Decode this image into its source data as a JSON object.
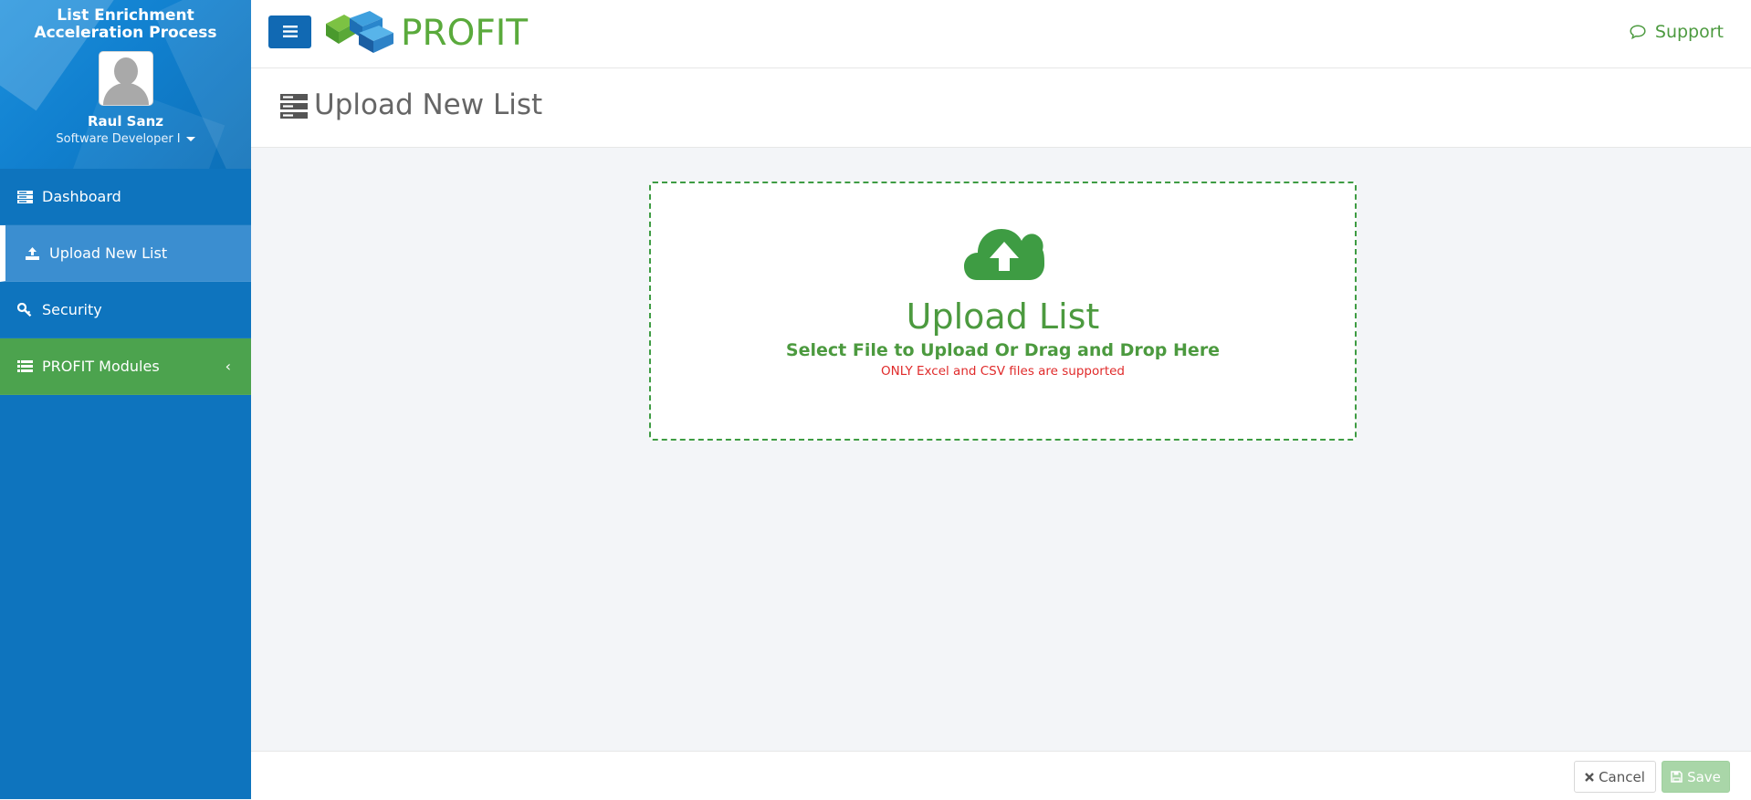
{
  "sidebar": {
    "app_title_line1": "List Enrichment",
    "app_title_line2": "Acceleration Process",
    "user": {
      "name": "Raul Sanz",
      "role": "Software Developer I"
    },
    "items": [
      {
        "label": "Dashboard",
        "icon": "dashboard-icon"
      },
      {
        "label": "Upload New List",
        "icon": "upload-icon",
        "active": true
      },
      {
        "label": "Security",
        "icon": "key-icon"
      },
      {
        "label": "PROFIT Modules",
        "icon": "list-icon",
        "chevron": "‹"
      }
    ]
  },
  "header": {
    "logo_text": "PROFIT",
    "support_label": "Support"
  },
  "page": {
    "title": "Upload New List"
  },
  "dropzone": {
    "title": "Upload List",
    "subtitle": "Select File to Upload Or Drag and Drop Here",
    "note": "ONLY Excel and CSV files are supported"
  },
  "footer": {
    "cancel_label": "Cancel",
    "save_label": "Save"
  },
  "colors": {
    "sidebar": "#0e74be",
    "active_item": "#3b8ed0",
    "modules_item": "#4ca34e",
    "brand_green": "#4c9a3f",
    "menu_button": "#1169b3",
    "error_text": "#e02b2b"
  }
}
